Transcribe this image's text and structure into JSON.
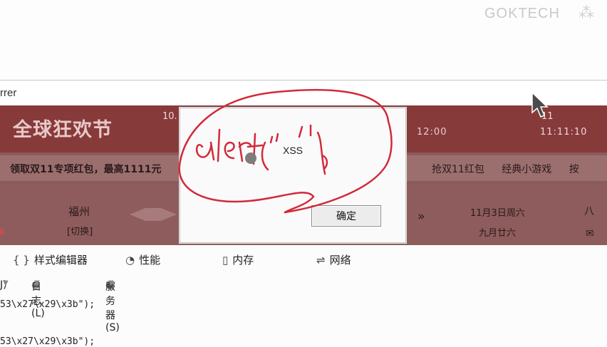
{
  "watermark": {
    "text": "GOKTECH"
  },
  "url_bar": {
    "text": "rrer"
  },
  "page": {
    "banner_title": "全球狂欢节",
    "banner_date_left": "10.",
    "banner_date_right": "11",
    "banner_mid": "12:00",
    "banner_right2": "11:11:10",
    "promo_left": "领取双11专项红包，最高1111元",
    "promo_right": [
      "抢双11红包",
      "经典小游戏",
      "按"
    ],
    "city": "福州",
    "city_switch": "[切换]",
    "arrow": "»",
    "date_line1": "11月3日周六",
    "date_line2": "九月廿六",
    "far_right": "八",
    "mail_icon": "✉"
  },
  "dialog": {
    "message": "XSS",
    "ok_label": "确定"
  },
  "annotation": {
    "handwriting": "alert(\"'\");"
  },
  "devtools": {
    "tabs": [
      {
        "icon": "{ }",
        "label": "样式编辑器"
      },
      {
        "icon": "◔",
        "label": "性能"
      },
      {
        "icon": "▯",
        "label": "内存"
      },
      {
        "icon": "⇌",
        "label": "网络"
      }
    ],
    "filters": {
      "f0": "J)",
      "f1": "日志(L)",
      "f2": "服务器(S)"
    },
    "code_lines": [
      "53\\x27\\x29\\x3b\");",
      "53\\x27\\x29\\x3b\");"
    ]
  },
  "colors": {
    "annotation": "#d22a3a",
    "banner": "#873a3a",
    "overlay": "#8c5a5a"
  }
}
